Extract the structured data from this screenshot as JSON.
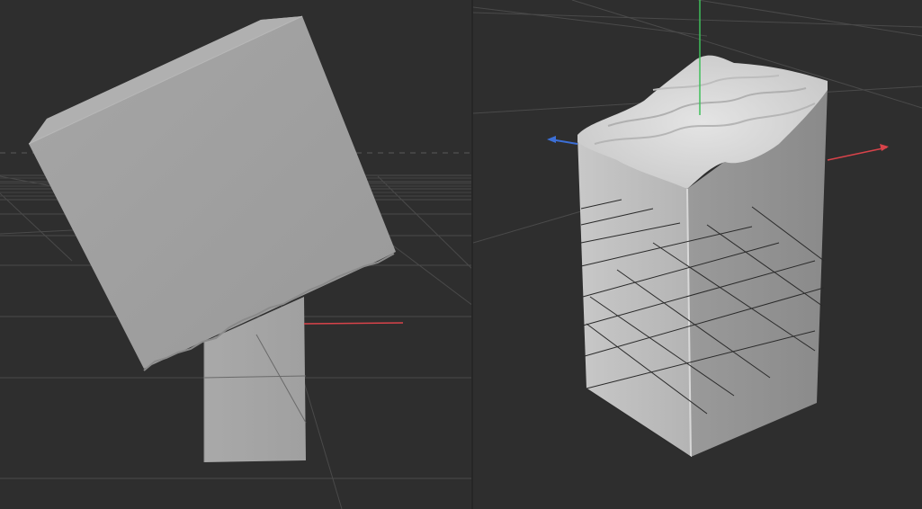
{
  "viewports": [
    {
      "id": "left",
      "content": "tilted-cube-over-block",
      "axis_colors": {
        "x": "#d8434a"
      }
    },
    {
      "id": "right",
      "content": "tall-block-with-displaced-top",
      "axis_colors": {
        "x": "#d8434a",
        "y": "#3fbf5a",
        "z": "#3c6fd6"
      }
    }
  ],
  "colors": {
    "background": "#2e2e2e",
    "grid_line": "#4a4a4a",
    "grid_line_dark": "#202020",
    "surface_light": "#cfcfcf",
    "surface_mid": "#a9a9a9",
    "surface_dark": "#8f8f8f"
  }
}
